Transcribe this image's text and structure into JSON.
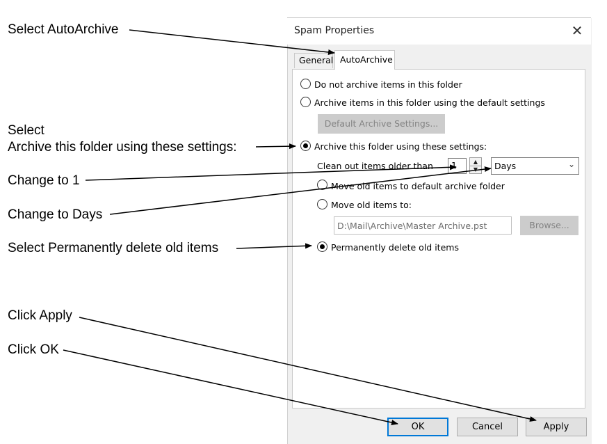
{
  "annotations": {
    "select_autoarchive": "Select AutoArchive",
    "select_line1": "Select",
    "select_line2": "Archive this folder using these settings:",
    "change_to_1": "Change to 1",
    "change_to_days": "Change to Days",
    "select_permanently": "Select Permanently delete old items",
    "click_apply": "Click Apply",
    "click_ok": "Click OK"
  },
  "dialog": {
    "title": "Spam Properties",
    "close_glyph": "✕",
    "tabs": [
      {
        "label": "General",
        "selected": false
      },
      {
        "label": "AutoArchive",
        "selected": true
      }
    ],
    "options": {
      "do_not_archive": "Do not archive items in this folder",
      "archive_default": "Archive items in this folder using the default settings",
      "default_settings_button": "Default Archive Settings...",
      "archive_custom": "Archive this folder using these settings:",
      "clean_out_label": "Clean out items older than",
      "clean_out_value": "1",
      "period_value": "Days",
      "move_default": "Move old items to default archive folder",
      "move_to": "Move old items to:",
      "archive_path": "D:\\Mail\\Archive\\Master Archive.pst",
      "browse_button": "Browse...",
      "permanently_delete": "Permanently delete old items"
    },
    "selected_archive_option": "archive_custom",
    "selected_old_items_option": "permanently_delete",
    "buttons": {
      "ok": "OK",
      "cancel": "Cancel",
      "apply": "Apply"
    }
  },
  "colors": {
    "ok_focus_border": "#0078d7",
    "dialog_background": "#f0f0f0"
  }
}
